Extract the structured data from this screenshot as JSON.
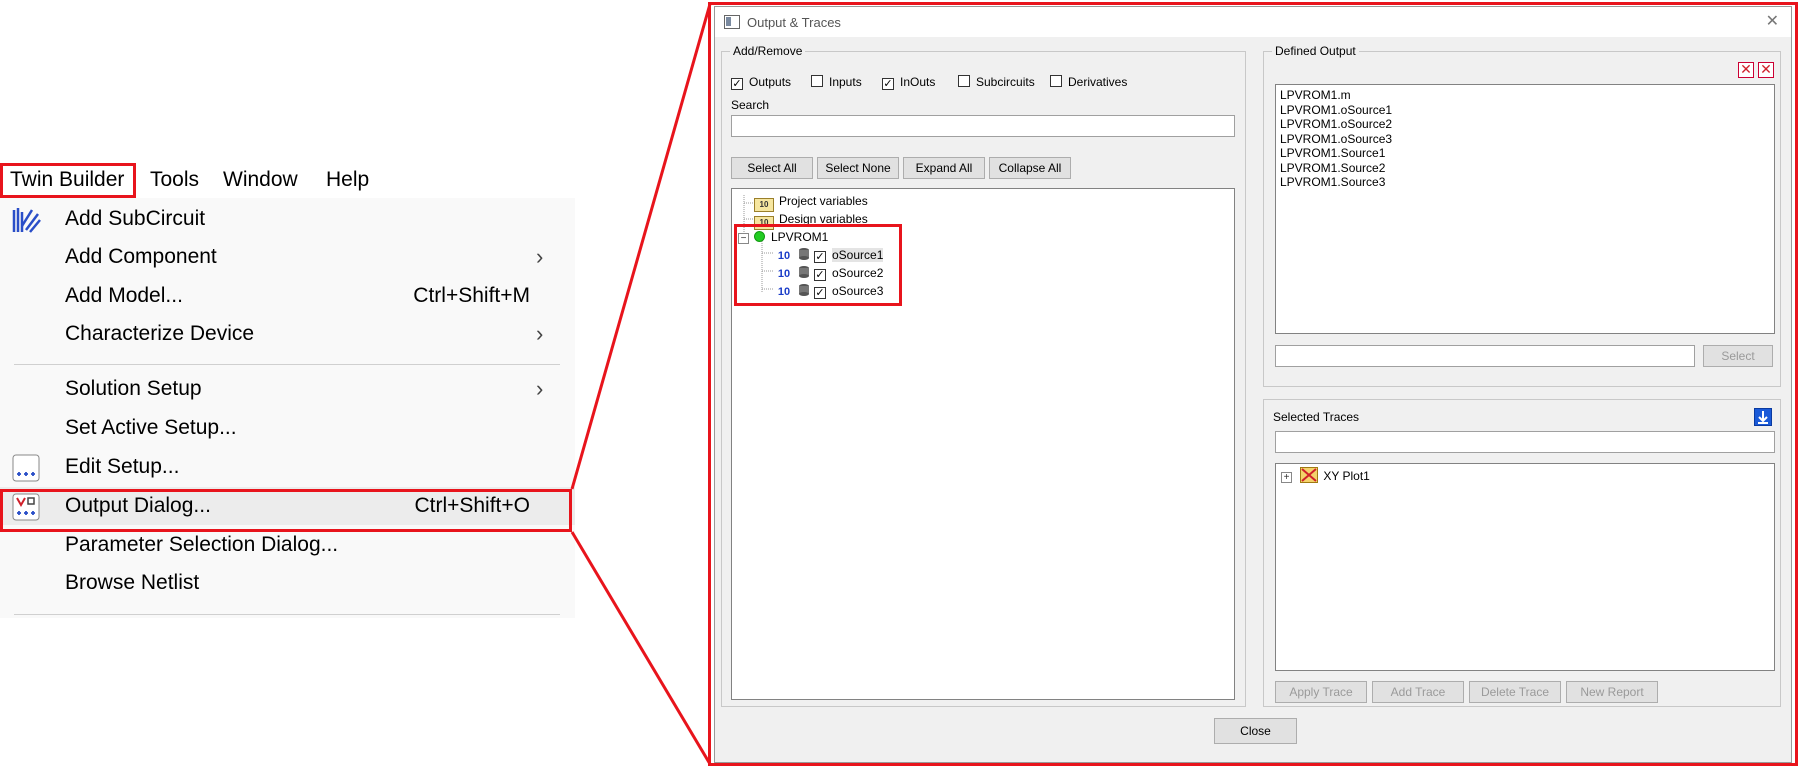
{
  "menubar": {
    "items": [
      "Twin Builder",
      "Tools",
      "Window",
      "Help"
    ]
  },
  "menu": {
    "add_subcircuit": "Add SubCircuit",
    "add_component": "Add Component",
    "add_model": "Add Model...",
    "add_model_shortcut": "Ctrl+Shift+M",
    "characterize_device": "Characterize Device",
    "solution_setup": "Solution Setup",
    "set_active_setup": "Set Active Setup...",
    "edit_setup": "Edit Setup...",
    "output_dialog": "Output Dialog...",
    "output_dialog_shortcut": "Ctrl+Shift+O",
    "parameter_selection": "Parameter Selection Dialog...",
    "browse_netlist": "Browse Netlist",
    "submenu_arrow": "›"
  },
  "dialog": {
    "title": "Output & Traces",
    "close_glyph": "✕",
    "add_remove": {
      "legend": "Add/Remove",
      "checkboxes": [
        {
          "label": "Outputs",
          "checked": true
        },
        {
          "label": "Inputs",
          "checked": false
        },
        {
          "label": "InOuts",
          "checked": true
        },
        {
          "label": "Subcircuits",
          "checked": false
        },
        {
          "label": "Derivatives",
          "checked": false
        }
      ],
      "search_label": "Search",
      "search_value": "",
      "buttons": [
        "Select All",
        "Select None",
        "Expand All",
        "Collapse All"
      ],
      "tree": {
        "project_variables": "Project variables",
        "design_variables": "Design variables",
        "component": "LPVROM1",
        "var_icon_text": "10",
        "children": [
          "oSource1",
          "oSource2",
          "oSource3"
        ]
      }
    },
    "defined_output": {
      "legend": "Defined Output",
      "items": [
        "LPVROM1.m",
        "LPVROM1.oSource1",
        "LPVROM1.oSource2",
        "LPVROM1.oSource3",
        "LPVROM1.Source1",
        "LPVROM1.Source2",
        "LPVROM1.Source3"
      ],
      "expression_value": "",
      "select_button": "Select"
    },
    "selected_traces": {
      "label": "Selected Traces",
      "filter_value": "",
      "plot": "XY Plot1",
      "buttons": [
        "Apply Trace",
        "Add Trace",
        "Delete Trace",
        "New Report"
      ]
    },
    "close_button": "Close"
  },
  "colors": {
    "highlight_red": "#e8141c",
    "menu_bg": "#f9f9f9",
    "dialog_bg": "#f0f0f0",
    "accent_blue": "#1a3cc8"
  }
}
